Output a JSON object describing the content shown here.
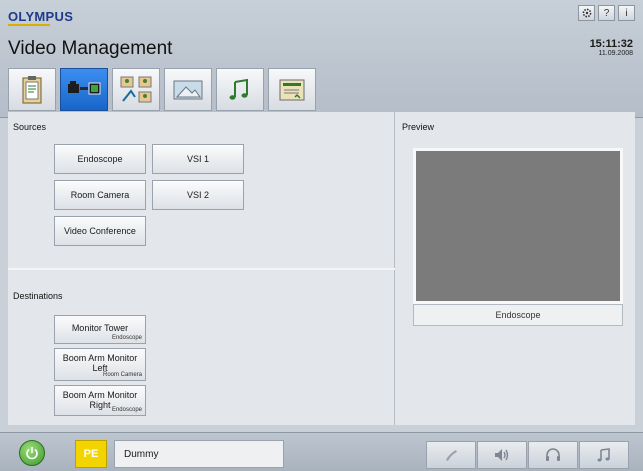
{
  "header": {
    "brand": "OLYMPUS",
    "title": "Video Management",
    "time": "15:11:32",
    "date": "11.09.2008",
    "top_buttons": [
      {
        "name": "settings-button",
        "glyph": "⚙"
      },
      {
        "name": "help-button",
        "glyph": "?"
      },
      {
        "name": "info-button",
        "glyph": "i"
      }
    ]
  },
  "tabs": [
    {
      "name": "tab-clipboard",
      "icon": "clipboard-icon",
      "active": false
    },
    {
      "name": "tab-video-routing",
      "icon": "video-routing-icon",
      "active": true
    },
    {
      "name": "tab-video-conference",
      "icon": "video-conference-icon",
      "active": false
    },
    {
      "name": "tab-image-capture",
      "icon": "image-icon",
      "active": false
    },
    {
      "name": "tab-music",
      "icon": "music-icon",
      "active": false
    },
    {
      "name": "tab-documentation",
      "icon": "document-icon",
      "active": false
    }
  ],
  "sources": {
    "title": "Sources",
    "buttons": [
      "Endoscope",
      "VSI 1",
      "Room Camera",
      "VSI 2",
      "Video Conference"
    ]
  },
  "destinations": {
    "title": "Destinations",
    "items": [
      {
        "label": "Monitor Tower",
        "source": "Endoscope"
      },
      {
        "label": "Boom Arm Monitor Left",
        "source": "Room Camera"
      },
      {
        "label": "Boom Arm Monitor Right",
        "source": "Endoscope"
      }
    ]
  },
  "preview": {
    "title": "Preview",
    "source_label": "Endoscope"
  },
  "footer": {
    "pe_label": "PE",
    "patient_name": "Dummy"
  },
  "colors": {
    "accent": "#1865c8",
    "pe_badge": "#f3d400",
    "power": "#3d9a2b"
  }
}
